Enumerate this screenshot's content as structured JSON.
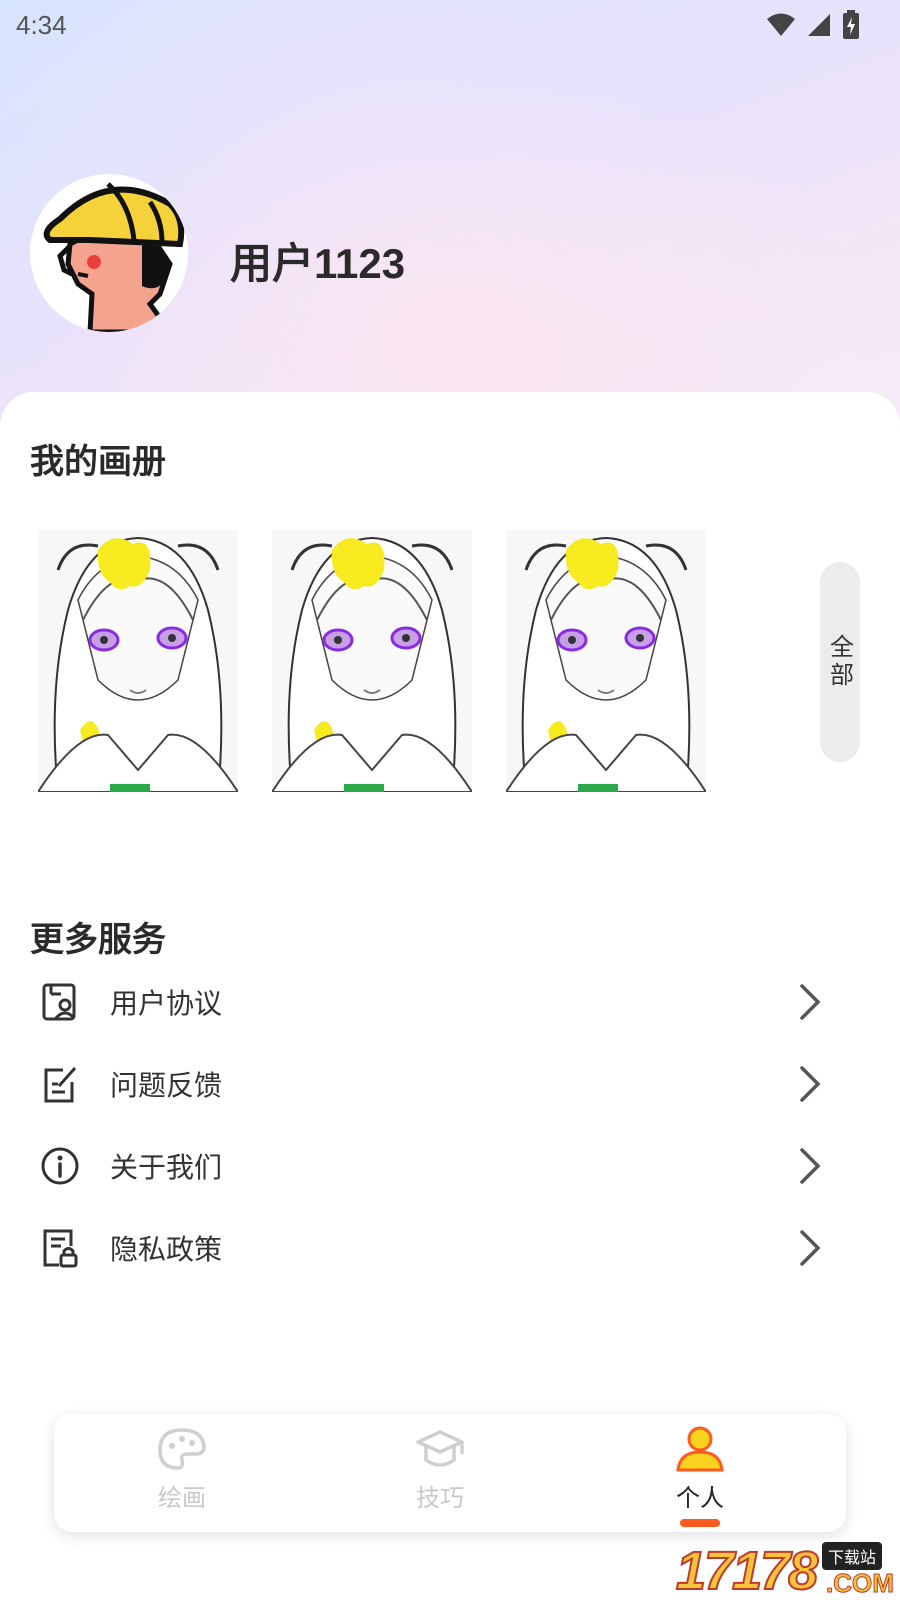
{
  "status_bar": {
    "time": "4:34"
  },
  "profile": {
    "username": "用户1123"
  },
  "album": {
    "title": "我的画册",
    "view_all_label": "全部",
    "thumbnails": [
      {
        "description": "anime-girl-sketch"
      },
      {
        "description": "anime-girl-sketch"
      },
      {
        "description": "anime-girl-sketch"
      }
    ]
  },
  "services": {
    "title": "更多服务",
    "items": [
      {
        "label": "用户协议",
        "icon": "user-agreement-icon"
      },
      {
        "label": "问题反馈",
        "icon": "feedback-icon"
      },
      {
        "label": "关于我们",
        "icon": "info-icon"
      },
      {
        "label": "隐私政策",
        "icon": "privacy-policy-icon"
      }
    ]
  },
  "bottom_nav": {
    "items": [
      {
        "label": "绘画",
        "icon": "palette-icon",
        "active": false
      },
      {
        "label": "技巧",
        "icon": "graduation-cap-icon",
        "active": false
      },
      {
        "label": "个人",
        "icon": "person-icon",
        "active": true
      }
    ],
    "active_color": "#ff5a1f"
  },
  "watermark": {
    "number": "17178",
    "badge": "下载站",
    "suffix": ".COM"
  }
}
